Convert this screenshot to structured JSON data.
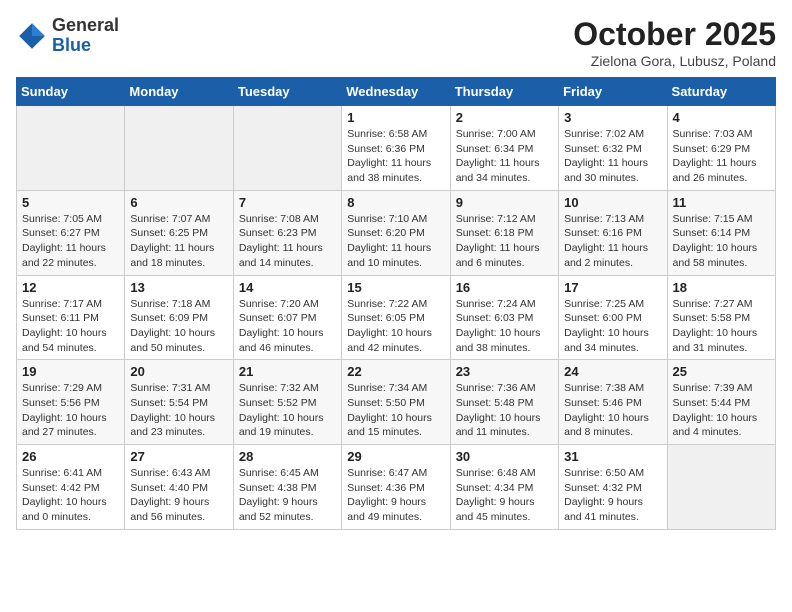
{
  "logo": {
    "general": "General",
    "blue": "Blue"
  },
  "header": {
    "month": "October 2025",
    "location": "Zielona Gora, Lubusz, Poland"
  },
  "weekdays": [
    "Sunday",
    "Monday",
    "Tuesday",
    "Wednesday",
    "Thursday",
    "Friday",
    "Saturday"
  ],
  "weeks": [
    [
      {
        "day": "",
        "info": ""
      },
      {
        "day": "",
        "info": ""
      },
      {
        "day": "",
        "info": ""
      },
      {
        "day": "1",
        "info": "Sunrise: 6:58 AM\nSunset: 6:36 PM\nDaylight: 11 hours and 38 minutes."
      },
      {
        "day": "2",
        "info": "Sunrise: 7:00 AM\nSunset: 6:34 PM\nDaylight: 11 hours and 34 minutes."
      },
      {
        "day": "3",
        "info": "Sunrise: 7:02 AM\nSunset: 6:32 PM\nDaylight: 11 hours and 30 minutes."
      },
      {
        "day": "4",
        "info": "Sunrise: 7:03 AM\nSunset: 6:29 PM\nDaylight: 11 hours and 26 minutes."
      }
    ],
    [
      {
        "day": "5",
        "info": "Sunrise: 7:05 AM\nSunset: 6:27 PM\nDaylight: 11 hours and 22 minutes."
      },
      {
        "day": "6",
        "info": "Sunrise: 7:07 AM\nSunset: 6:25 PM\nDaylight: 11 hours and 18 minutes."
      },
      {
        "day": "7",
        "info": "Sunrise: 7:08 AM\nSunset: 6:23 PM\nDaylight: 11 hours and 14 minutes."
      },
      {
        "day": "8",
        "info": "Sunrise: 7:10 AM\nSunset: 6:20 PM\nDaylight: 11 hours and 10 minutes."
      },
      {
        "day": "9",
        "info": "Sunrise: 7:12 AM\nSunset: 6:18 PM\nDaylight: 11 hours and 6 minutes."
      },
      {
        "day": "10",
        "info": "Sunrise: 7:13 AM\nSunset: 6:16 PM\nDaylight: 11 hours and 2 minutes."
      },
      {
        "day": "11",
        "info": "Sunrise: 7:15 AM\nSunset: 6:14 PM\nDaylight: 10 hours and 58 minutes."
      }
    ],
    [
      {
        "day": "12",
        "info": "Sunrise: 7:17 AM\nSunset: 6:11 PM\nDaylight: 10 hours and 54 minutes."
      },
      {
        "day": "13",
        "info": "Sunrise: 7:18 AM\nSunset: 6:09 PM\nDaylight: 10 hours and 50 minutes."
      },
      {
        "day": "14",
        "info": "Sunrise: 7:20 AM\nSunset: 6:07 PM\nDaylight: 10 hours and 46 minutes."
      },
      {
        "day": "15",
        "info": "Sunrise: 7:22 AM\nSunset: 6:05 PM\nDaylight: 10 hours and 42 minutes."
      },
      {
        "day": "16",
        "info": "Sunrise: 7:24 AM\nSunset: 6:03 PM\nDaylight: 10 hours and 38 minutes."
      },
      {
        "day": "17",
        "info": "Sunrise: 7:25 AM\nSunset: 6:00 PM\nDaylight: 10 hours and 34 minutes."
      },
      {
        "day": "18",
        "info": "Sunrise: 7:27 AM\nSunset: 5:58 PM\nDaylight: 10 hours and 31 minutes."
      }
    ],
    [
      {
        "day": "19",
        "info": "Sunrise: 7:29 AM\nSunset: 5:56 PM\nDaylight: 10 hours and 27 minutes."
      },
      {
        "day": "20",
        "info": "Sunrise: 7:31 AM\nSunset: 5:54 PM\nDaylight: 10 hours and 23 minutes."
      },
      {
        "day": "21",
        "info": "Sunrise: 7:32 AM\nSunset: 5:52 PM\nDaylight: 10 hours and 19 minutes."
      },
      {
        "day": "22",
        "info": "Sunrise: 7:34 AM\nSunset: 5:50 PM\nDaylight: 10 hours and 15 minutes."
      },
      {
        "day": "23",
        "info": "Sunrise: 7:36 AM\nSunset: 5:48 PM\nDaylight: 10 hours and 11 minutes."
      },
      {
        "day": "24",
        "info": "Sunrise: 7:38 AM\nSunset: 5:46 PM\nDaylight: 10 hours and 8 minutes."
      },
      {
        "day": "25",
        "info": "Sunrise: 7:39 AM\nSunset: 5:44 PM\nDaylight: 10 hours and 4 minutes."
      }
    ],
    [
      {
        "day": "26",
        "info": "Sunrise: 6:41 AM\nSunset: 4:42 PM\nDaylight: 10 hours and 0 minutes."
      },
      {
        "day": "27",
        "info": "Sunrise: 6:43 AM\nSunset: 4:40 PM\nDaylight: 9 hours and 56 minutes."
      },
      {
        "day": "28",
        "info": "Sunrise: 6:45 AM\nSunset: 4:38 PM\nDaylight: 9 hours and 52 minutes."
      },
      {
        "day": "29",
        "info": "Sunrise: 6:47 AM\nSunset: 4:36 PM\nDaylight: 9 hours and 49 minutes."
      },
      {
        "day": "30",
        "info": "Sunrise: 6:48 AM\nSunset: 4:34 PM\nDaylight: 9 hours and 45 minutes."
      },
      {
        "day": "31",
        "info": "Sunrise: 6:50 AM\nSunset: 4:32 PM\nDaylight: 9 hours and 41 minutes."
      },
      {
        "day": "",
        "info": ""
      }
    ]
  ]
}
